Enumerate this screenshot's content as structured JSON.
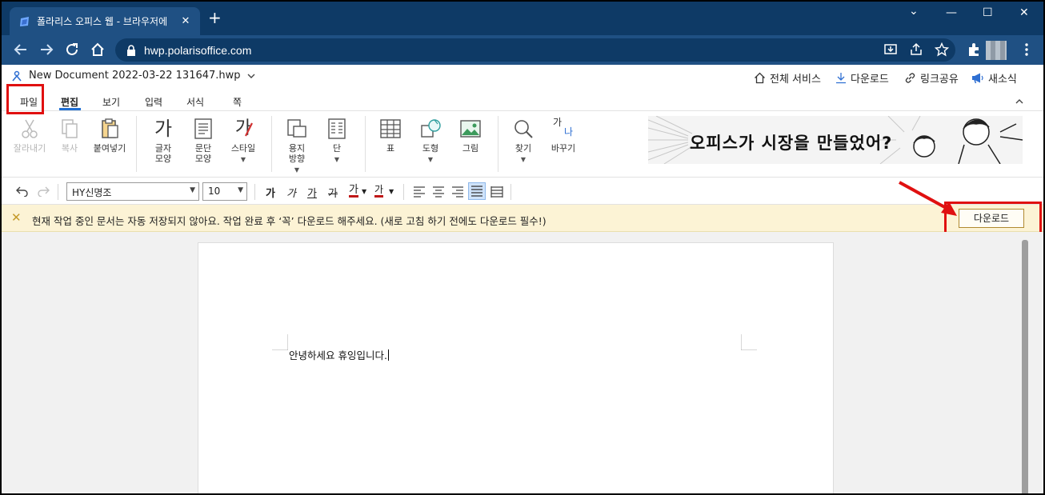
{
  "browser": {
    "tab_title": "폴라리스 오피스 웹 - 브라우저에",
    "tab_close": "✕",
    "new_tab": "+",
    "url": "hwp.polarisoffice.com",
    "window_controls": [
      "⌄",
      "—",
      "☐",
      "✕"
    ]
  },
  "doc": {
    "title": "New Document 2022-03-22 131647.hwp",
    "actions": {
      "all_services": "전체 서비스",
      "download": "다운로드",
      "share_link": "링크공유",
      "news": "새소식"
    }
  },
  "menu_tabs": [
    "파일",
    "편집",
    "보기",
    "입력",
    "서식",
    "쪽"
  ],
  "ribbon": {
    "cut": "잘라내기",
    "copy": "복사",
    "paste": "붙여넣기",
    "char_shape_1": "글자",
    "char_shape_2": "모양",
    "para_shape_1": "문단",
    "para_shape_2": "모양",
    "style": "스타일",
    "paper_dir_1": "용지",
    "paper_dir_2": "방향",
    "columns": "단",
    "table": "표",
    "shape": "도형",
    "picture": "그림",
    "find": "찾기",
    "replace": "바꾸기",
    "icon_char": "가",
    "icon_style": "가",
    "icon_replace_a": "가",
    "icon_replace_b": "나"
  },
  "banner": {
    "text": "오피스가 시장을 만들었어?"
  },
  "format": {
    "font": "HY신명조",
    "size": "10",
    "bold": "가",
    "italic": "가",
    "underline": "가",
    "strike": "가",
    "color": "가",
    "highlight": "가"
  },
  "notice": {
    "text": "현재 작업 중인 문서는 자동 저장되지 않아요. 작업 완료 후 ‘꼭’ 다운로드 해주세요. (새로 고침 하기 전에도 다운로드 필수!)",
    "button": "다운로드"
  },
  "document": {
    "text": "안녕하세요 휴잉입니다."
  },
  "colors": {
    "titlebar": "#0e3a66",
    "addressbar": "#1f5083",
    "highlight": "#e01010",
    "notice_bg": "#fcf3d5",
    "accent": "#1f6fd4"
  }
}
